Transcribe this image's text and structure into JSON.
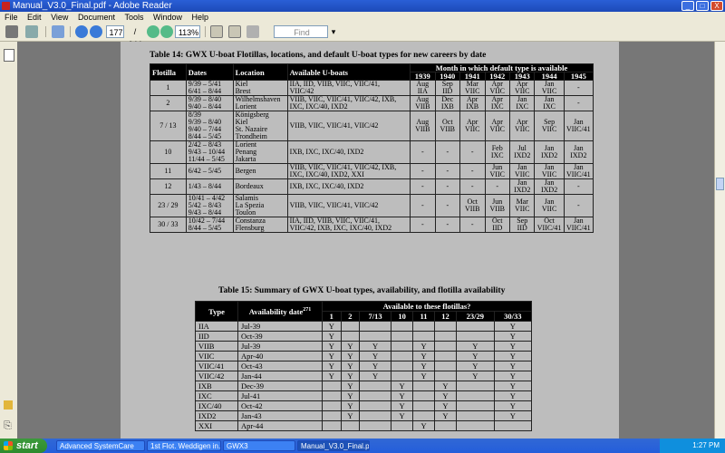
{
  "window": {
    "title": "Manual_V3.0_Final.pdf - Adobe Reader",
    "buttons": [
      "_",
      "□",
      "X"
    ]
  },
  "menu": [
    "File",
    "Edit",
    "View",
    "Document",
    "Tools",
    "Window",
    "Help"
  ],
  "toolbar": {
    "page_current": "177",
    "page_total": "/ 644",
    "zoom": "113%",
    "find_placeholder": "Find"
  },
  "table14": {
    "caption": "Table 14: GWX U-boat Flotillas, locations, and default U-boat types for new careers by date",
    "headers": [
      "Flotilla",
      "Dates",
      "Location",
      "Available U-boats",
      "Month in which default type is available"
    ],
    "years": [
      "1939",
      "1940",
      "1941",
      "1942",
      "1943",
      "1944",
      "1945"
    ],
    "rows": [
      {
        "flotilla": "1",
        "dates": "9/39 – 5/41\n6/41 – 8/44",
        "location": "Kiel\nBrest",
        "boats": "IIA, IID, VIIB, VIIC, VIIC/41,\nVIIC/42",
        "months": [
          "Aug\nIIA",
          "Sep\nIID",
          "Mar\nVIIC",
          "Apr\nVIIC",
          "Apr\nVIIC",
          "Jan\nVIIC",
          "-"
        ]
      },
      {
        "flotilla": "2",
        "dates": "9/39 – 8/40\n9/40 – 8/44",
        "location": "Wilhelmshaven\nLorient",
        "boats": "VIIB, VIIC, VIIC/41, VIIC/42, IXB,\nIXC, IXC/40, IXD2",
        "months": [
          "Aug\nVIIB",
          "Dec\nIXB",
          "Apr\nIXB",
          "Apr\nIXC",
          "Jan\nIXC",
          "Jan\nIXC",
          "-"
        ]
      },
      {
        "flotilla": "7 / 13",
        "dates": "8/39\n9/39 – 8/40\n9/40 – 7/44\n8/44 – 5/45",
        "location": "Königsberg\nKiel\nSt. Nazaire\nTrondheim",
        "boats": "VIIB, VIIC, VIIC/41, VIIC/42",
        "months": [
          "Aug\nVIIB",
          "Oct\nVIIB",
          "Apr\nVIIC",
          "Apr\nVIIC",
          "Apr\nVIIC",
          "Sep\nVIIC",
          "Jan\nVIIC/41"
        ]
      },
      {
        "flotilla": "10",
        "dates": "2/42 – 8/43\n9/43 – 10/44\n11/44 – 5/45",
        "location": "Lorient\nPenang\nJakarta",
        "boats": "IXB, IXC, IXC/40, IXD2",
        "months": [
          "-",
          "-",
          "-",
          "Feb\nIXC",
          "Jul\nIXD2",
          "Jan\nIXD2",
          "Jan\nIXD2"
        ]
      },
      {
        "flotilla": "11",
        "dates": "6/42 – 5/45",
        "location": "Bergen",
        "boats": "VIIB, VIIC, VIIC/41, VIIC/42, IXB,\nIXC, IXC/40, IXD2, XXI",
        "months": [
          "-",
          "-",
          "-",
          "Jun\nVIIC",
          "Jan\nVIIC",
          "Jan\nVIIC",
          "Jan\nVIIC/41"
        ]
      },
      {
        "flotilla": "12",
        "dates": "1/43 – 8/44",
        "location": "Bordeaux",
        "boats": "IXB, IXC, IXC/40, IXD2",
        "months": [
          "-",
          "-",
          "-",
          "-",
          "Jan\nIXD2",
          "Jan\nIXD2",
          "-"
        ]
      },
      {
        "flotilla": "23 / 29",
        "dates": "10/41 – 4/42\n5/42 – 8/43\n9/43 – 8/44",
        "location": "Salamis\nLa Spezia\nToulon",
        "boats": "VIIB, VIIC, VIIC/41, VIIC/42",
        "months": [
          "-",
          "-",
          "Oct\nVIIB",
          "Jun\nVIIB",
          "Mar\nVIIC",
          "Jan\nVIIC",
          "-"
        ]
      },
      {
        "flotilla": "30 / 33",
        "dates": "10/42 – 7/44\n8/44 – 5/45",
        "location": "Constanza\nFlensburg",
        "boats": "IIA, IID, VIIB, VIIC, VIIC/41,\nVIIC/42, IXB, IXC, IXC/40, IXD2",
        "months": [
          "-",
          "-",
          "-",
          "Oct\nIID",
          "Sep\nIID",
          "Oct\nVIIC/41",
          "Jan\nVIIC/41"
        ]
      }
    ]
  },
  "table15": {
    "caption": "Table 15: Summary of GWX U-boat types, availability, and flotilla availability",
    "headers": [
      "Type",
      "Availability date",
      "Available to these flotillas?"
    ],
    "footnote_ref": "271",
    "flotillas": [
      "1",
      "2",
      "7/13",
      "10",
      "11",
      "12",
      "23/29",
      "30/33"
    ],
    "rows": [
      {
        "type": "IIA",
        "date": "Jul-39",
        "marks": [
          "Y",
          "",
          "",
          "",
          "",
          "",
          "",
          "Y"
        ]
      },
      {
        "type": "IID",
        "date": "Oct-39",
        "marks": [
          "Y",
          "",
          "",
          "",
          "",
          "",
          "",
          "Y"
        ]
      },
      {
        "type": "VIIB",
        "date": "Jul-39",
        "marks": [
          "Y",
          "Y",
          "Y",
          "",
          "Y",
          "",
          "Y",
          "Y"
        ]
      },
      {
        "type": "VIIC",
        "date": "Apr-40",
        "marks": [
          "Y",
          "Y",
          "Y",
          "",
          "Y",
          "",
          "Y",
          "Y"
        ]
      },
      {
        "type": "VIIC/41",
        "date": "Oct-43",
        "marks": [
          "Y",
          "Y",
          "Y",
          "",
          "Y",
          "",
          "Y",
          "Y"
        ]
      },
      {
        "type": "VIIC/42",
        "date": "Jan-44",
        "marks": [
          "Y",
          "Y",
          "Y",
          "",
          "Y",
          "",
          "Y",
          "Y"
        ]
      },
      {
        "type": "IXB",
        "date": "Dec-39",
        "marks": [
          "",
          "Y",
          "",
          "Y",
          "",
          "Y",
          "",
          "Y"
        ]
      },
      {
        "type": "IXC",
        "date": "Jul-41",
        "marks": [
          "",
          "Y",
          "",
          "Y",
          "",
          "Y",
          "",
          "Y"
        ]
      },
      {
        "type": "IXC/40",
        "date": "Oct-42",
        "marks": [
          "",
          "Y",
          "",
          "Y",
          "",
          "Y",
          "",
          "Y"
        ]
      },
      {
        "type": "IXD2",
        "date": "Jan-43",
        "marks": [
          "",
          "Y",
          "",
          "Y",
          "",
          "Y",
          "",
          "Y"
        ]
      },
      {
        "type": "XXI",
        "date": "Apr-44",
        "marks": [
          "",
          "",
          "",
          "",
          "Y",
          "",
          "",
          ""
        ]
      }
    ]
  },
  "taskbar": {
    "start": "start",
    "tasks": [
      "Advanced SystemCare",
      "1st Flot. Weddigen in...",
      "GWX3",
      "Manual_V3.0_Final.p..."
    ],
    "clock": "1:27 PM"
  }
}
